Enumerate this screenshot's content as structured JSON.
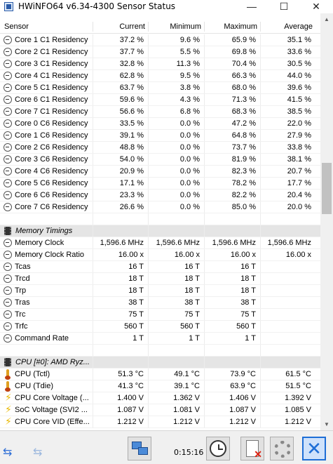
{
  "window": {
    "title": "HWiNFO64 v6.34-4300 Sensor Status"
  },
  "columns": [
    "Sensor",
    "Current",
    "Minimum",
    "Maximum",
    "Average"
  ],
  "rows": [
    {
      "kind": "sensor",
      "icon": "clock-icon",
      "name": "Core 1 C1 Residency",
      "cur": "37.2 %",
      "min": "9.6 %",
      "max": "65.9 %",
      "avg": "35.1 %"
    },
    {
      "kind": "sensor",
      "icon": "clock-icon",
      "name": "Core 2 C1 Residency",
      "cur": "37.7 %",
      "min": "5.5 %",
      "max": "69.8 %",
      "avg": "33.6 %"
    },
    {
      "kind": "sensor",
      "icon": "clock-icon",
      "name": "Core 3 C1 Residency",
      "cur": "32.8 %",
      "min": "11.3 %",
      "max": "70.4 %",
      "avg": "30.5 %"
    },
    {
      "kind": "sensor",
      "icon": "clock-icon",
      "name": "Core 4 C1 Residency",
      "cur": "62.8 %",
      "min": "9.5 %",
      "max": "66.3 %",
      "avg": "44.0 %"
    },
    {
      "kind": "sensor",
      "icon": "clock-icon",
      "name": "Core 5 C1 Residency",
      "cur": "63.7 %",
      "min": "3.8 %",
      "max": "68.0 %",
      "avg": "39.6 %"
    },
    {
      "kind": "sensor",
      "icon": "clock-icon",
      "name": "Core 6 C1 Residency",
      "cur": "59.6 %",
      "min": "4.3 %",
      "max": "71.3 %",
      "avg": "41.5 %"
    },
    {
      "kind": "sensor",
      "icon": "clock-icon",
      "name": "Core 7 C1 Residency",
      "cur": "56.6 %",
      "min": "6.8 %",
      "max": "68.3 %",
      "avg": "38.5 %"
    },
    {
      "kind": "sensor",
      "icon": "clock-icon",
      "name": "Core 0 C6 Residency",
      "cur": "33.5 %",
      "min": "0.0 %",
      "max": "47.2 %",
      "avg": "22.0 %"
    },
    {
      "kind": "sensor",
      "icon": "clock-icon",
      "name": "Core 1 C6 Residency",
      "cur": "39.1 %",
      "min": "0.0 %",
      "max": "64.8 %",
      "avg": "27.9 %"
    },
    {
      "kind": "sensor",
      "icon": "clock-icon",
      "name": "Core 2 C6 Residency",
      "cur": "48.8 %",
      "min": "0.0 %",
      "max": "73.7 %",
      "avg": "33.8 %"
    },
    {
      "kind": "sensor",
      "icon": "clock-icon",
      "name": "Core 3 C6 Residency",
      "cur": "54.0 %",
      "min": "0.0 %",
      "max": "81.9 %",
      "avg": "38.1 %"
    },
    {
      "kind": "sensor",
      "icon": "clock-icon",
      "name": "Core 4 C6 Residency",
      "cur": "20.9 %",
      "min": "0.0 %",
      "max": "82.3 %",
      "avg": "20.7 %"
    },
    {
      "kind": "sensor",
      "icon": "clock-icon",
      "name": "Core 5 C6 Residency",
      "cur": "17.1 %",
      "min": "0.0 %",
      "max": "78.2 %",
      "avg": "17.7 %"
    },
    {
      "kind": "sensor",
      "icon": "clock-icon",
      "name": "Core 6 C6 Residency",
      "cur": "23.3 %",
      "min": "0.0 %",
      "max": "82.2 %",
      "avg": "20.4 %"
    },
    {
      "kind": "sensor",
      "icon": "clock-icon",
      "name": "Core 7 C6 Residency",
      "cur": "26.6 %",
      "min": "0.0 %",
      "max": "85.0 %",
      "avg": "20.0 %"
    },
    {
      "kind": "blank"
    },
    {
      "kind": "group",
      "icon": "memory-chip-icon",
      "name": "Memory Timings"
    },
    {
      "kind": "sensor",
      "icon": "clock-icon",
      "name": "Memory Clock",
      "cur": "1,596.6 MHz",
      "min": "1,596.6 MHz",
      "max": "1,596.6 MHz",
      "avg": "1,596.6 MHz"
    },
    {
      "kind": "sensor",
      "icon": "clock-icon",
      "name": "Memory Clock Ratio",
      "cur": "16.00 x",
      "min": "16.00 x",
      "max": "16.00 x",
      "avg": "16.00 x"
    },
    {
      "kind": "sensor",
      "icon": "clock-icon",
      "name": "Tcas",
      "cur": "16 T",
      "min": "16 T",
      "max": "16 T",
      "avg": ""
    },
    {
      "kind": "sensor",
      "icon": "clock-icon",
      "name": "Trcd",
      "cur": "18 T",
      "min": "18 T",
      "max": "18 T",
      "avg": ""
    },
    {
      "kind": "sensor",
      "icon": "clock-icon",
      "name": "Trp",
      "cur": "18 T",
      "min": "18 T",
      "max": "18 T",
      "avg": ""
    },
    {
      "kind": "sensor",
      "icon": "clock-icon",
      "name": "Tras",
      "cur": "38 T",
      "min": "38 T",
      "max": "38 T",
      "avg": ""
    },
    {
      "kind": "sensor",
      "icon": "clock-icon",
      "name": "Trc",
      "cur": "75 T",
      "min": "75 T",
      "max": "75 T",
      "avg": ""
    },
    {
      "kind": "sensor",
      "icon": "clock-icon",
      "name": "Trfc",
      "cur": "560 T",
      "min": "560 T",
      "max": "560 T",
      "avg": ""
    },
    {
      "kind": "sensor",
      "icon": "clock-icon",
      "name": "Command Rate",
      "cur": "1 T",
      "min": "1 T",
      "max": "1 T",
      "avg": ""
    },
    {
      "kind": "blank"
    },
    {
      "kind": "group",
      "icon": "cpu-chip-icon",
      "name": "CPU [#0]: AMD Ryz..."
    },
    {
      "kind": "sensor",
      "icon": "thermometer-icon",
      "name": "CPU (Tctl)",
      "cur": "51.3 °C",
      "min": "49.1 °C",
      "max": "73.9 °C",
      "avg": "61.5 °C"
    },
    {
      "kind": "sensor",
      "icon": "thermometer-icon",
      "name": "CPU (Tdie)",
      "cur": "41.3 °C",
      "min": "39.1 °C",
      "max": "63.9 °C",
      "avg": "51.5 °C"
    },
    {
      "kind": "sensor",
      "icon": "voltage-bolt-icon",
      "name": "CPU Core Voltage (...",
      "cur": "1.400 V",
      "min": "1.362 V",
      "max": "1.406 V",
      "avg": "1.392 V"
    },
    {
      "kind": "sensor",
      "icon": "voltage-bolt-icon",
      "name": "SoC Voltage (SVI2 ...",
      "cur": "1.087 V",
      "min": "1.081 V",
      "max": "1.087 V",
      "avg": "1.085 V"
    },
    {
      "kind": "sensor",
      "icon": "voltage-bolt-icon",
      "name": "CPU Core VID (Effe...",
      "cur": "1.212 V",
      "min": "1.212 V",
      "max": "1.212 V",
      "avg": "1.212 V"
    }
  ],
  "statusbar": {
    "elapsed": "0:15:16"
  },
  "colors": {
    "accent": "#1e6ed6",
    "group_bg": "#e5e5e5",
    "thermo": "#e0a020",
    "bolt": "#e8b800"
  }
}
